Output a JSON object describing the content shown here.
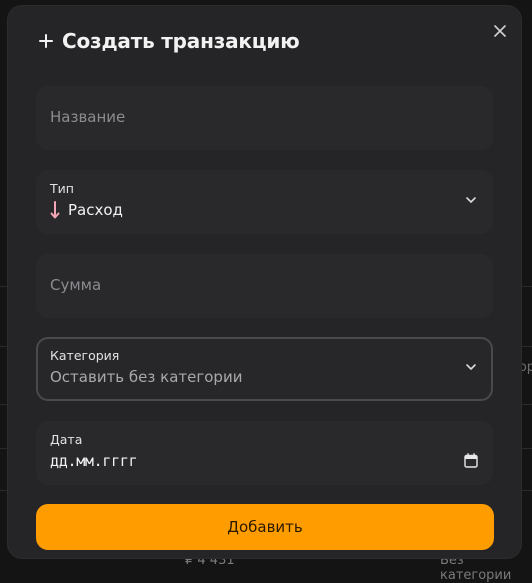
{
  "modal": {
    "title": "Создать транзакцию",
    "submit_label": "Добавить"
  },
  "form": {
    "name": {
      "placeholder": "Название"
    },
    "type": {
      "label": "Тип",
      "value": "Расход",
      "icon": "arrow-down-icon",
      "icon_color": "#f4a6b8"
    },
    "amount": {
      "placeholder": "Сумма"
    },
    "category": {
      "label": "Категория",
      "value": "Оставить без категории"
    },
    "date": {
      "label": "Дата",
      "value": "дд.мм.гггг"
    }
  },
  "background": {
    "bottom_amount": "₽ 4 431",
    "bottom_category": "Без категории",
    "right_edge_text": "гори"
  },
  "colors": {
    "accent": "#ff9c00",
    "modal_bg": "#252527",
    "field_bg": "#29292c"
  }
}
